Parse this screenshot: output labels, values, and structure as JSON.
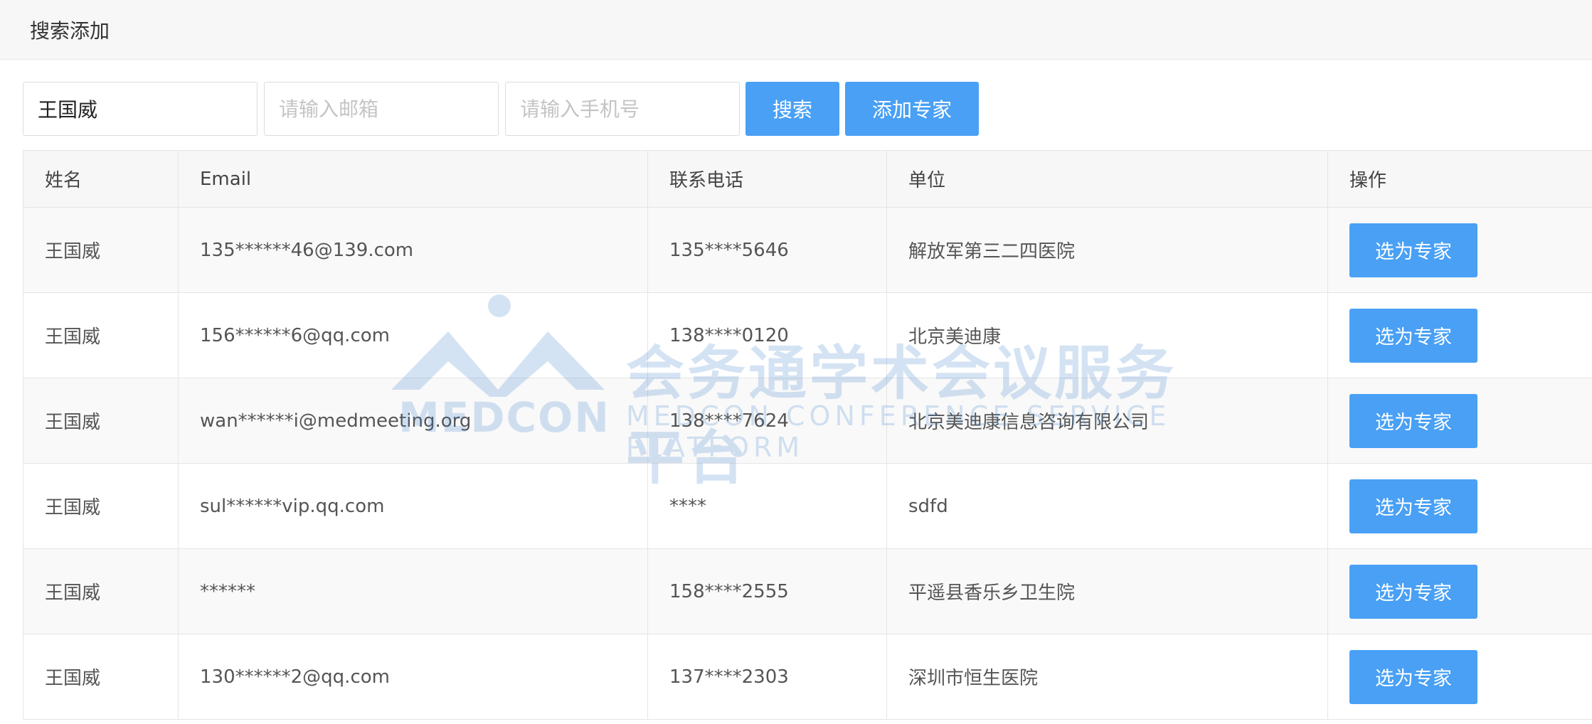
{
  "panel": {
    "title": "搜索添加"
  },
  "search": {
    "name_value": "王国威",
    "email_placeholder": "请输入邮箱",
    "phone_placeholder": "请输入手机号",
    "search_label": "搜索",
    "add_label": "添加专家"
  },
  "table": {
    "headers": [
      "姓名",
      "Email",
      "联系电话",
      "单位",
      "操作"
    ],
    "action_label": "选为专家",
    "rows": [
      {
        "name": "王国威",
        "email": "135******46@139.com",
        "phone": "135****5646",
        "org": "解放军第三二四医院"
      },
      {
        "name": "王国威",
        "email": "156******6@qq.com",
        "phone": "138****0120",
        "org": "北京美迪康"
      },
      {
        "name": "王国威",
        "email": "wan******i@medmeeting.org",
        "phone": "138****7624",
        "org": "北京美迪康信息咨询有限公司"
      },
      {
        "name": "王国威",
        "email": "sul******vip.qq.com",
        "phone": "****",
        "org": "sdfd"
      },
      {
        "name": "王国威",
        "email": "******",
        "phone": "158****2555",
        "org": "平遥县香乐乡卫生院"
      },
      {
        "name": "王国威",
        "email": "130******2@qq.com",
        "phone": "137****2303",
        "org": "深圳市恒生医院"
      }
    ]
  },
  "watermark": {
    "logo_text": "MEDCON",
    "title_cn": "会务通学术会议服务平台",
    "title_en": "MEDCON CONFERENCE SERVICE PLATFORM",
    "color": "#2f78c8"
  },
  "colors": {
    "primary": "#49a0f5",
    "header_bg": "#f7f7f7",
    "border": "#e5e5e5"
  }
}
